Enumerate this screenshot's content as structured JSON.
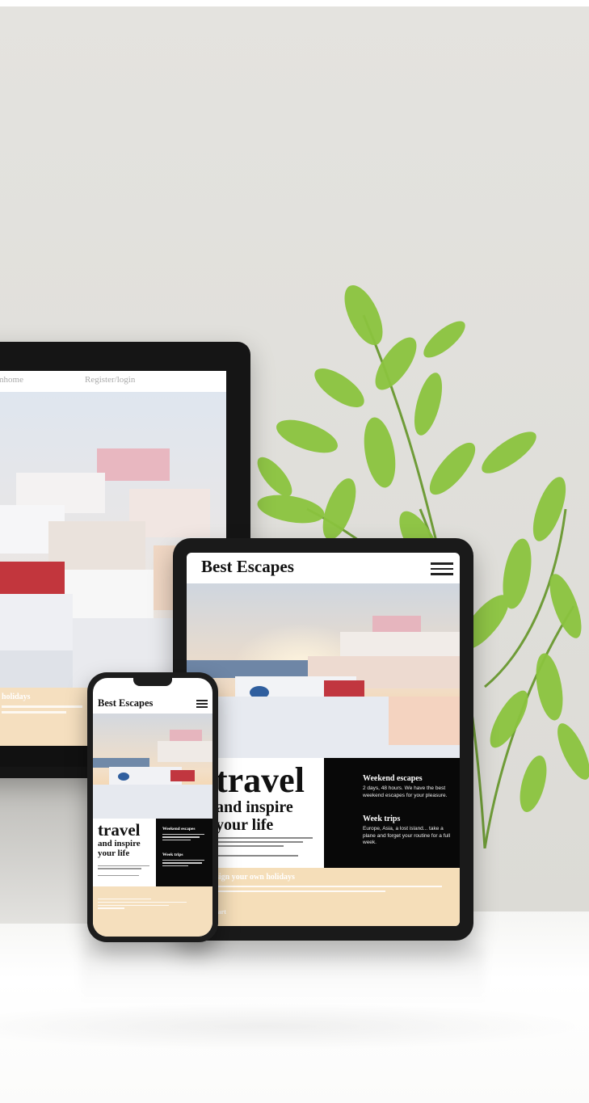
{
  "desktop": {
    "nav": [
      "mhome",
      "Register/login"
    ],
    "band_title": "holidays"
  },
  "tablet": {
    "brand": "Best Escapes",
    "hero_title": "travel",
    "hero_subtitle_1": "and inspire",
    "hero_subtitle_2": "your life",
    "aside": [
      {
        "title": "Weekend escapes",
        "text": "2 days, 48 hours. We have the best weekend escapes for your pleasure."
      },
      {
        "title": "Week trips",
        "text": "Europe, Asia, a lost island... take a plane and forget your routine for a full week."
      }
    ],
    "cta_title": "sign your own holidays",
    "cta_start": "tart"
  },
  "phone": {
    "brand": "Best Escapes",
    "hero_title": "travel",
    "hero_subtitle_1": "and inspire",
    "hero_subtitle_2": "your life",
    "aside": [
      {
        "title": "Weekend escapes"
      },
      {
        "title": "Week trips"
      }
    ]
  },
  "colors": {
    "wall": "#e3e2de",
    "cta_beige": "#f5deb9",
    "device_black": "#1a1a1a"
  }
}
